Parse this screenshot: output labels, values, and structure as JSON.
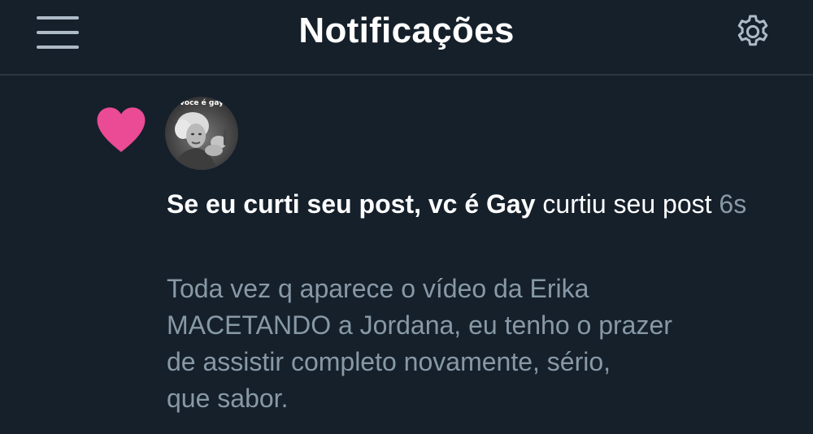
{
  "header": {
    "title": "Notificações",
    "menu_icon": "hamburger-menu-icon",
    "settings_icon": "gear-icon"
  },
  "notification": {
    "type_icon": "heart-icon",
    "type_color": "#e0245e",
    "avatar_caption": "voce é gay",
    "actor_name": "Se eu curti seu post, vc é Gay",
    "action_text": "curtiu seu post",
    "time": "6s",
    "post_preview": "Toda vez q aparece o vídeo da Erika\nMACETANDO a Jordana, eu tenho o prazer\nde assistir completo novamente, sério,\nque sabor."
  },
  "colors": {
    "background": "#15202b",
    "text_primary": "#ffffff",
    "text_secondary": "#8899a6",
    "divider": "#2c3640",
    "heart": "#e0245e"
  }
}
